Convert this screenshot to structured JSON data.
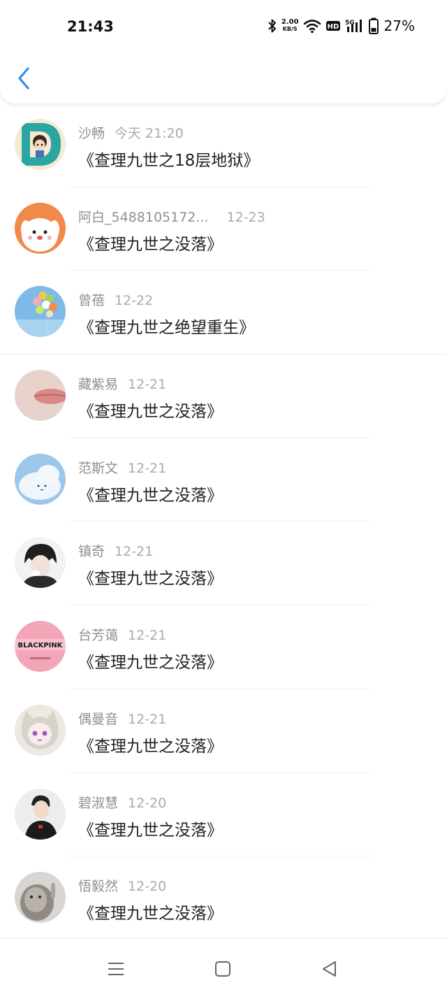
{
  "status": {
    "time": "21:43",
    "net_speed_value": "2.00",
    "net_speed_unit": "KB/S",
    "battery": "27%"
  },
  "items": [
    {
      "name": "沙畅",
      "date": "今天 21:20",
      "message": "《查理九世之18层地狱》"
    },
    {
      "name": "阿白_5488105172...",
      "date": "12-23",
      "message": "《查理九世之没落》"
    },
    {
      "name": "曾蓓",
      "date": "12-22",
      "message": "《查理九世之绝望重生》"
    },
    {
      "name": "藏紫易",
      "date": "12-21",
      "message": "《查理九世之没落》"
    },
    {
      "name": "范斯文",
      "date": "12-21",
      "message": "《查理九世之没落》"
    },
    {
      "name": "镇奇",
      "date": "12-21",
      "message": "《查理九世之没落》"
    },
    {
      "name": "台芳蔼",
      "date": "12-21",
      "message": "《查理九世之没落》"
    },
    {
      "name": "偶曼音",
      "date": "12-21",
      "message": "《查理九世之没落》"
    },
    {
      "name": "碧淑慧",
      "date": "12-20",
      "message": "《查理九世之没落》"
    },
    {
      "name": "悟毅然",
      "date": "12-20",
      "message": "《查理九世之没落》"
    }
  ],
  "avatar_texts": {
    "blackpink": "BLACKPINK"
  },
  "colors": {
    "accent": "#2f8ff0",
    "name": "#8f8f8f",
    "date": "#aaaaaa",
    "message": "#222222"
  }
}
